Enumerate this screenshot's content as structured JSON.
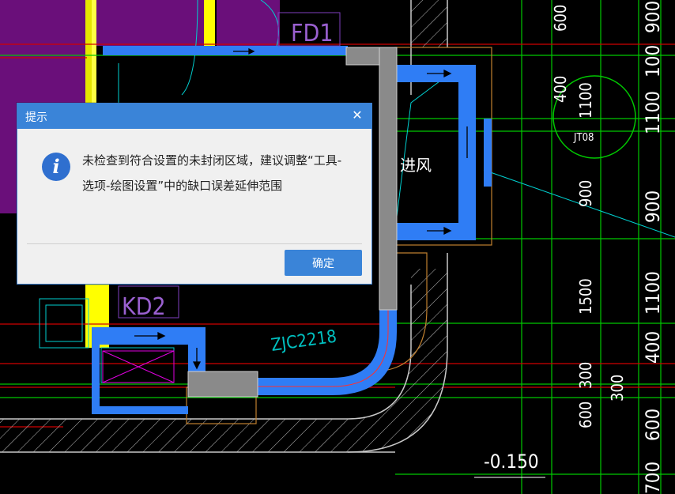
{
  "dialog": {
    "title": "提示",
    "close_glyph": "✕",
    "message": "未检查到符合设置的未封闭区域，建议调整“工具-选项-绘图设置”中的缺口误差延伸范围",
    "ok_label": "确定",
    "icon": "info-icon"
  },
  "cad_labels": {
    "fd1": "FD1",
    "kd2": "KD2",
    "jt08": "JT08",
    "jinfeng": "进风",
    "zjc": "ZJC2218",
    "elev": "-0.150",
    "dim_400": "400",
    "dim_1100_a": "1100",
    "dim_900_a": "900",
    "dim_1500": "1500",
    "dim_300": "300",
    "dim_600_a": "600",
    "dim_600_top": "600",
    "dim_900_r": "900",
    "dim_100": "100",
    "dim_1100_r": "1100",
    "dim_900_r2": "900",
    "dim_1100_r3": "1100",
    "dim_400_r": "400",
    "dim_300_r": "300",
    "dim_600_r": "600",
    "dim_700": "700"
  },
  "colors": {
    "duct_blue": "#2f7df5",
    "wall_purple": "#6a0f7a",
    "grid_green": "#00c800",
    "axis_red": "#d00000",
    "dialog_blue": "#3a84d8"
  }
}
